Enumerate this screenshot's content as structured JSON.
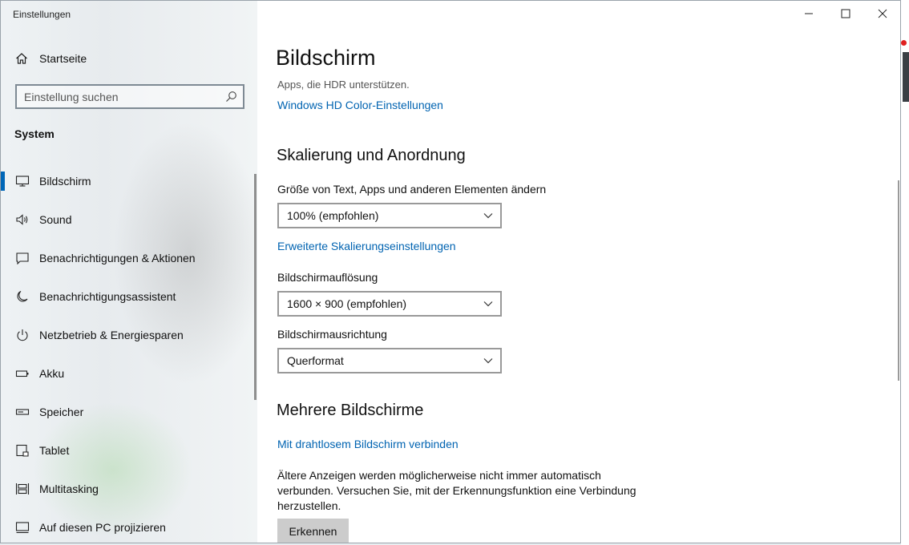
{
  "window": {
    "title": "Einstellungen"
  },
  "sidebar": {
    "home_label": "Startseite",
    "search_placeholder": "Einstellung suchen",
    "section_label": "System",
    "items": [
      {
        "label": "Bildschirm",
        "icon": "monitor-icon",
        "active": true
      },
      {
        "label": "Sound",
        "icon": "speaker-icon"
      },
      {
        "label": "Benachrichtigungen & Aktionen",
        "icon": "message-icon"
      },
      {
        "label": "Benachrichtigungsassistent",
        "icon": "moon-icon"
      },
      {
        "label": "Netzbetrieb & Energiesparen",
        "icon": "power-icon"
      },
      {
        "label": "Akku",
        "icon": "battery-icon"
      },
      {
        "label": "Speicher",
        "icon": "storage-icon"
      },
      {
        "label": "Tablet",
        "icon": "tablet-icon"
      },
      {
        "label": "Multitasking",
        "icon": "multitasking-icon"
      },
      {
        "label": "Auf diesen PC projizieren",
        "icon": "project-icon"
      }
    ]
  },
  "main": {
    "title": "Bildschirm",
    "hdr_apps_text": "Apps, die HDR unterstützen.",
    "hdr_link": "Windows HD Color-Einstellungen",
    "scaling_heading": "Skalierung und Anordnung",
    "size_label": "Größe von Text, Apps und anderen Elementen ändern",
    "size_value": "100% (empfohlen)",
    "advanced_scaling_link": "Erweiterte Skalierungseinstellungen",
    "resolution_label": "Bildschirmauflösung",
    "resolution_value": "1600 × 900 (empfohlen)",
    "orientation_label": "Bildschirmausrichtung",
    "orientation_value": "Querformat",
    "multi_heading": "Mehrere Bildschirme",
    "wireless_link": "Mit drahtlosem Bildschirm verbinden",
    "detect_text": "Ältere Anzeigen werden möglicherweise nicht immer automatisch verbunden. Versuchen Sie, mit der Erkennungsfunktion eine Verbindung herzustellen.",
    "detect_button": "Erkennen"
  },
  "colors": {
    "accent": "#0067b8",
    "link": "#0063b1"
  }
}
